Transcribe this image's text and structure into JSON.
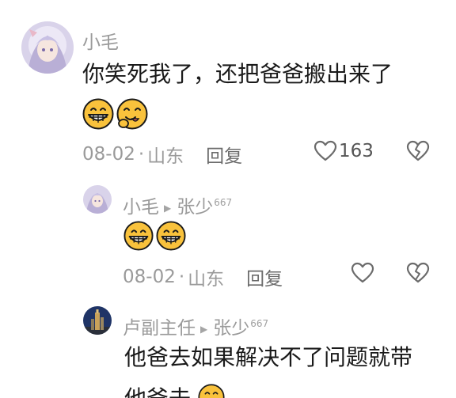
{
  "comments": [
    {
      "author": "小毛",
      "text": "你笑死我了，还把爸爸搬出来了",
      "emojis": [
        "grin-emoji",
        "yummy-emoji"
      ],
      "date": "08-02",
      "location": "山东",
      "reply_label": "回复",
      "likes": "163"
    },
    {
      "author": "小毛",
      "reply_to": "张少",
      "reply_badge": "667",
      "emojis": [
        "grin-emoji",
        "grin-emoji"
      ],
      "date": "08-02",
      "location": "山东",
      "reply_label": "回复"
    },
    {
      "author": "卢副主任",
      "reply_to": "张少",
      "reply_badge": "667",
      "text": "他爸去如果解决不了问题就带",
      "text_cut": "他爸去"
    }
  ],
  "separator": "·",
  "colors": {
    "meta_gray": "#9a9a9a",
    "text": "#1a1a1a",
    "emoji_yellow": "#f9c23c"
  }
}
